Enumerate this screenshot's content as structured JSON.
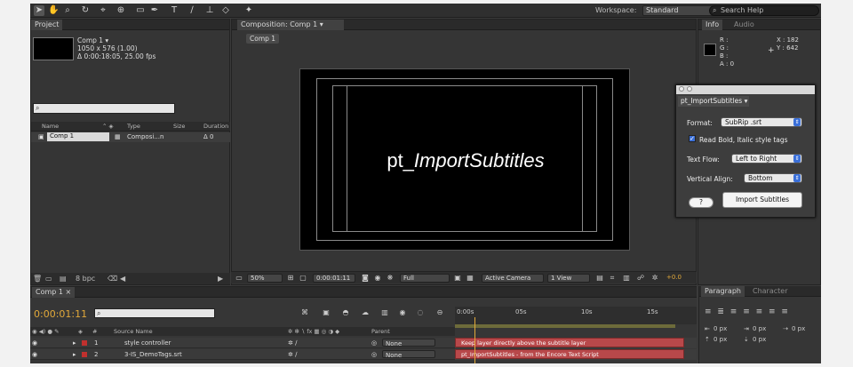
{
  "toolbar": {
    "workspace_label": "Workspace:",
    "workspace_value": "Standard",
    "search_placeholder": "Search Help"
  },
  "project": {
    "tab": "Project",
    "comp_name": "Comp 1 ▾",
    "comp_size": "1050 x 576 (1.00)",
    "comp_duration": "Δ 0:00:18:05, 25.00 fps",
    "columns": [
      "Name",
      "Type",
      "Size",
      "Duration"
    ],
    "items": [
      {
        "name": "Comp 1",
        "type": "Composi...n",
        "duration": "Δ 0"
      }
    ],
    "bpc": "8 bpc"
  },
  "composition": {
    "tab": "Composition: Comp 1",
    "breadcrumb": "Comp 1",
    "viewer_text_prefix": "pt_",
    "viewer_text_italic": "ImportSubtitles",
    "zoom": "50%",
    "timecode": "0:00:01:11",
    "resolution": "Full",
    "camera": "Active Camera",
    "view": "1 View",
    "exposure": "+0.0"
  },
  "info": {
    "tab_info": "Info",
    "tab_audio": "Audio",
    "r": "R :",
    "g": "G :",
    "b": "B :",
    "a": "A : 0",
    "x": "X : 182",
    "y": "Y : 642"
  },
  "dialog": {
    "tab": "pt_ImportSubtitles",
    "format_label": "Format:",
    "format_value": "SubRip .srt",
    "bold_label": "Read Bold, Italic style tags",
    "textflow_label": "Text Flow:",
    "textflow_value": "Left to Right",
    "valign_label": "Vertical Align:",
    "valign_value": "Bottom",
    "help_label": "?",
    "import_label": "Import Subtitles"
  },
  "timeline": {
    "tab": "Comp 1",
    "time": "0:00:01:11",
    "col_source": "Source Name",
    "col_parent": "Parent",
    "rows": [
      {
        "num": "1",
        "name": "style controller",
        "parent": "None",
        "clip_text": "Keep layer directly above the subtitle layer"
      },
      {
        "num": "2",
        "name": "3-IS_DemoTags.srt",
        "parent": "None",
        "clip_text": "pt_ImportSubtitles - from the Encore Text Script"
      }
    ],
    "ruler": [
      "0:00s",
      "05s",
      "10s",
      "15s"
    ]
  },
  "paragraph": {
    "tab_paragraph": "Paragraph",
    "tab_character": "Character",
    "v1": "0 px",
    "v2": "0 px",
    "v3": "0 px",
    "v4": "0 px",
    "v5": "0 px"
  }
}
